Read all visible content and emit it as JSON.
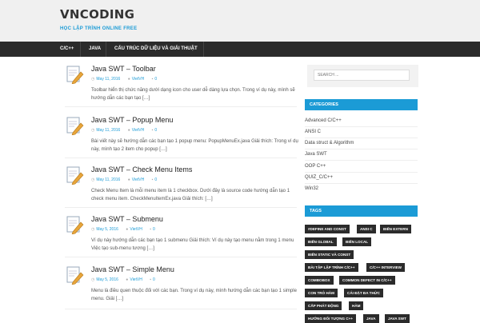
{
  "header": {
    "site_title": "VNCODING",
    "site_description": "HỌC LẬP TRÌNH ONLINE FREE"
  },
  "nav": {
    "items": [
      "C/C++",
      "JAVA",
      "CẤU TRÚC DỮ LIỆU VÀ GIẢI THUẬT"
    ]
  },
  "posts": [
    {
      "title": "Java SWT – Toolbar",
      "date": "May 11, 2016",
      "author": "VietVH",
      "comments": "0",
      "excerpt": "Toolbar hiển thị chức năng dưới dạng icon cho user dễ dàng lựa chọn. Trong ví dụ này, mình sẽ hướng dẫn các bạn tạo […]"
    },
    {
      "title": "Java SWT – Popup Menu",
      "date": "May 11, 2016",
      "author": "VietVH",
      "comments": "0",
      "excerpt": "Bài viết này sẽ hướng dẫn các bạn tạo 1 popup menu: PopupMenuEx.java Giải thích: Trong ví dụ này, mình tạo 2 item cho popup […]"
    },
    {
      "title": "Java SWT – Check Menu Items",
      "date": "May 11, 2016",
      "author": "VietVH",
      "comments": "0",
      "excerpt": "Check Menu Item là mỗi menu item là 1 checkbox. Dưới đây là source code hướng dẫn tạo 1 check menu item. CheckMenuItemEx.java Giải thích: […]"
    },
    {
      "title": "Java SWT – Submenu",
      "date": "May 5, 2016",
      "author": "VietVH",
      "comments": "0",
      "excerpt": "Ví dụ này hướng dẫn các bạn tạo 1 submenu Giải thích: Ví dụ này tạo menu nằm trong 1 menu Việc tạo sub-menu tương […]"
    },
    {
      "title": "Java SWT – Simple Menu",
      "date": "May 5, 2016",
      "author": "VietVH",
      "comments": "0",
      "excerpt": "Menu là điều quen thuộc đối với các bạn. Trong ví dụ này, mình hướng dẫn các bạn tạo 1 simple menu. Giải […]"
    }
  ],
  "sidebar": {
    "search_placeholder": "SEARCH ...",
    "categories_title": "CATEGORIES",
    "categories": [
      "Advanced C/C++",
      "ANSI C",
      "Data struct & Algorithm",
      "Java SWT",
      "OOP C++",
      "QUIZ_C/C++",
      "Win32"
    ],
    "tags_title": "TAGS",
    "tags": [
      "#DEFINE AND CONST",
      "ANSI C",
      "BIẾN EXTERN",
      "BIẾN GLOBAL",
      "BIẾN LOCAL",
      "BIẾN STATIC VÀ CONST",
      "BÀI TẬP LẬP TRÌNH C/C++",
      "C/C++ INTERVIEW",
      "COMBOBOX",
      "COMMON DEFECT IN C/C++",
      "CON TRỎ HÀM",
      "CÁI ĐẶT ĐA THỨC",
      "CẤP PHÁT ĐỘNG",
      "HÀM",
      "HƯỚNG ĐỐI TƯỢNG C++",
      "JAVA",
      "JAVA SWT"
    ]
  },
  "colors": {
    "accent": "#1b9bd6",
    "nav_bg": "#2b2b2b",
    "tag_bg": "#2b2b2b"
  }
}
